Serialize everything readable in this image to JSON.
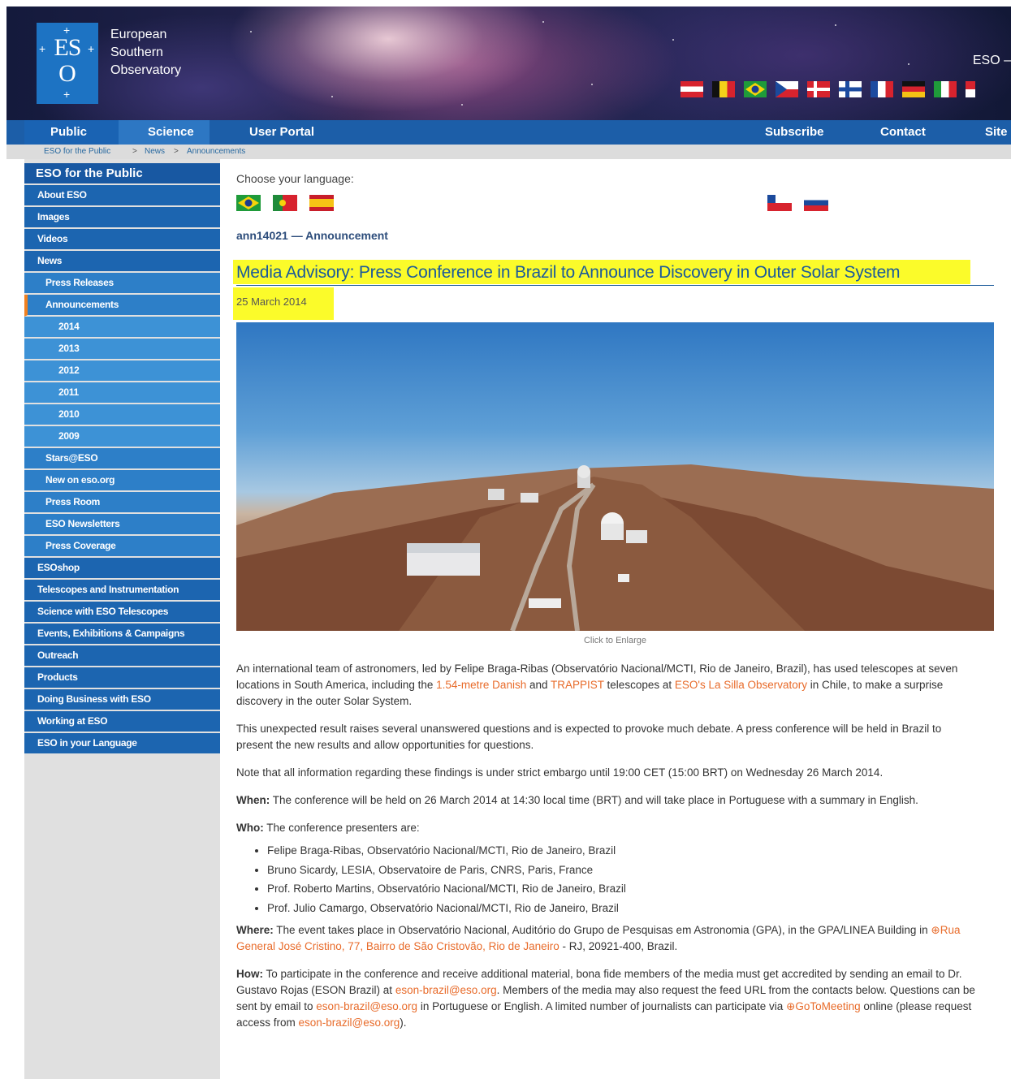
{
  "header": {
    "logo_text": "ES",
    "logo_o": "O",
    "org_line1": "European",
    "org_line2": "Southern",
    "org_line3": "Observatory",
    "eso_right": "ESO –"
  },
  "nav": {
    "public": "Public",
    "science": "Science",
    "user_portal": "User Portal",
    "subscribe": "Subscribe",
    "contact": "Contact",
    "site": "Site"
  },
  "breadcrumb": {
    "item1": "ESO for the Public",
    "sep": ">",
    "item2": "News",
    "item3": "Announcements"
  },
  "sidebar": {
    "title": "ESO for the Public",
    "items": [
      {
        "label": "About ESO"
      },
      {
        "label": "Images"
      },
      {
        "label": "Videos"
      },
      {
        "label": "News"
      },
      {
        "label": "Press Releases"
      },
      {
        "label": "Announcements"
      },
      {
        "label": "2014"
      },
      {
        "label": "2013"
      },
      {
        "label": "2012"
      },
      {
        "label": "2011"
      },
      {
        "label": "2010"
      },
      {
        "label": "2009"
      },
      {
        "label": "Stars@ESO"
      },
      {
        "label": "New on eso.org"
      },
      {
        "label": "Press Room"
      },
      {
        "label": "ESO Newsletters"
      },
      {
        "label": "Press Coverage"
      },
      {
        "label": "ESOshop"
      },
      {
        "label": "Telescopes and Instrumentation"
      },
      {
        "label": "Science with ESO Telescopes"
      },
      {
        "label": "Events, Exhibitions & Campaigns"
      },
      {
        "label": "Outreach"
      },
      {
        "label": "Products"
      },
      {
        "label": "Doing Business with ESO"
      },
      {
        "label": "Working at ESO"
      },
      {
        "label": "ESO in your Language"
      }
    ]
  },
  "content": {
    "language_label": "Choose your language:",
    "ann_id": "ann14021 — Announcement",
    "title": "Media Advisory: Press Conference in Brazil to Announce Discovery in Outer Solar System",
    "date": "25 March 2014",
    "caption": "Click to Enlarge",
    "p1_a": "An international team of astronomers, led by Felipe Braga-Ribas (Observatório Nacional/MCTI, Rio de Janeiro, Brazil), has used telescopes at seven locations in South America, including the ",
    "p1_link1": "1.54-metre Danish",
    "p1_b": " and ",
    "p1_link2": "TRAPPIST",
    "p1_c": " telescopes at ",
    "p1_link3": "ESO's La Silla Observatory",
    "p1_d": " in Chile, to make a surprise discovery in the outer Solar System.",
    "p2": "This unexpected result raises several unanswered questions and is expected to provoke much debate. A press conference will be held in Brazil to present the new results and allow opportunities for questions.",
    "p3": "Note that all information regarding these findings is under strict embargo until 19:00 CET (15:00 BRT) on Wednesday 26 March 2014.",
    "when_label": "When:",
    "when_text": " The conference will be held on 26 March 2014 at 14:30 local time (BRT) and will take place in Portuguese with a summary in English.",
    "who_label": "Who:",
    "who_text": " The conference presenters are:",
    "presenters": [
      "Felipe Braga-Ribas, Observatório Nacional/MCTI, Rio de Janeiro, Brazil",
      "Bruno Sicardy, LESIA, Observatoire de Paris, CNRS, Paris, France",
      "Prof. Roberto Martins, Observatório Nacional/MCTI, Rio de Janeiro, Brazil",
      "Prof. Julio Camargo, Observatório Nacional/MCTI, Rio de Janeiro, Brazil"
    ],
    "where_label": "Where:",
    "where_a": " The event takes place in Observatório Nacional, Auditório do Grupo de Pesquisas em Astronomia (GPA), in the GPA/LINEA Building in ",
    "where_link": "Rua General José Cristino, 77, Bairro de São Cristovão, Rio de Janeiro",
    "where_b": " - RJ, 20921-400, Brazil.",
    "how_label": "How:",
    "how_a": " To participate in the conference and receive additional material, bona fide members of the media must get accredited by sending an email to Dr. Gustavo Rojas (ESON Brazil) at ",
    "how_email1": "eson-brazil@eso.org",
    "how_b": ". Members of the media may also request the feed URL from the contacts below. Questions can be sent by email to ",
    "how_email2": "eson-brazil@eso.org",
    "how_c": " in Portuguese or English. A limited number of journalists can participate via ",
    "how_link": "GoToMeeting",
    "how_d": " online (please request access from ",
    "how_email3": "eson-brazil@eso.org",
    "how_e": ")."
  },
  "colors": {
    "nav_blue": "#1c5ea8",
    "sidebar_blue": "#1c65b0",
    "link_orange": "#e86b2a",
    "highlight_yellow": "#fbfb2a",
    "title_blue": "#1b5a9a"
  },
  "icons": {
    "flags_header": [
      "austria-flag",
      "belgium-flag",
      "brazil-flag",
      "czech-flag",
      "denmark-flag",
      "finland-flag",
      "france-flag",
      "germany-flag",
      "italy-flag"
    ],
    "flags_language": [
      "brazil-flag",
      "portugal-flag",
      "spain-flag",
      "chile-flag",
      "russia-flag"
    ]
  }
}
